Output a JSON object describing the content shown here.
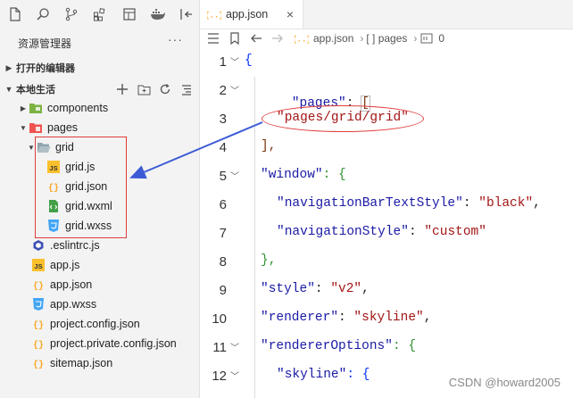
{
  "sidebar": {
    "icons": [
      "files-icon",
      "search-icon",
      "source-control-icon",
      "extensions-icon",
      "layout-icon",
      "docker-icon",
      "split-icon"
    ],
    "explorer_title": "资源管理器",
    "more": "···",
    "open_editors_label": "打开的编辑器",
    "workspace_label": "本地生活",
    "tree": [
      {
        "label": "components",
        "type": "folder-blue"
      },
      {
        "label": "pages",
        "type": "folder-red"
      },
      {
        "label": "grid",
        "type": "folder"
      },
      {
        "label": "grid.js",
        "type": "js"
      },
      {
        "label": "grid.json",
        "type": "json"
      },
      {
        "label": "grid.wxml",
        "type": "wxml"
      },
      {
        "label": "grid.wxss",
        "type": "wxss"
      },
      {
        "label": ".eslintrc.js",
        "type": "eslint"
      },
      {
        "label": "app.js",
        "type": "js"
      },
      {
        "label": "app.json",
        "type": "json"
      },
      {
        "label": "app.wxss",
        "type": "wxss"
      },
      {
        "label": "project.config.json",
        "type": "json"
      },
      {
        "label": "project.private.config.json",
        "type": "json"
      },
      {
        "label": "sitemap.json",
        "type": "json"
      }
    ]
  },
  "editor": {
    "tab_label": "app.json",
    "tab_close": "×",
    "breadcrumb": [
      "app.json",
      "[ ] pages",
      "0"
    ],
    "lines": [
      "1",
      "2",
      "3",
      "4",
      "5",
      "6",
      "7",
      "8",
      "9",
      "10",
      "11",
      "12"
    ],
    "code": {
      "l1": "{",
      "l2_key": "\"pages\"",
      "l2_colon": ": ",
      "l2_br": "[",
      "l3_val": "\"pages/grid/grid\"",
      "l4": "],",
      "l5_key": "\"window\"",
      "l5_rest": ": {",
      "l6_key": "\"navigationBarTextStyle\"",
      "l6_val": "\"black\"",
      "l7_key": "\"navigationStyle\"",
      "l7_val": "\"custom\"",
      "l8": "},",
      "l9_key": "\"style\"",
      "l9_val": "\"v2\"",
      "l10_key": "\"renderer\"",
      "l10_val": "\"skyline\"",
      "l11_key": "\"rendererOptions\"",
      "l11_rest": ": {",
      "l12_key": "\"skyline\"",
      "l12_rest": ": {"
    }
  },
  "watermark": "CSDN @howard2005",
  "colors": {
    "annotation": "#e03c3c",
    "arrow": "#3d5bd6"
  }
}
